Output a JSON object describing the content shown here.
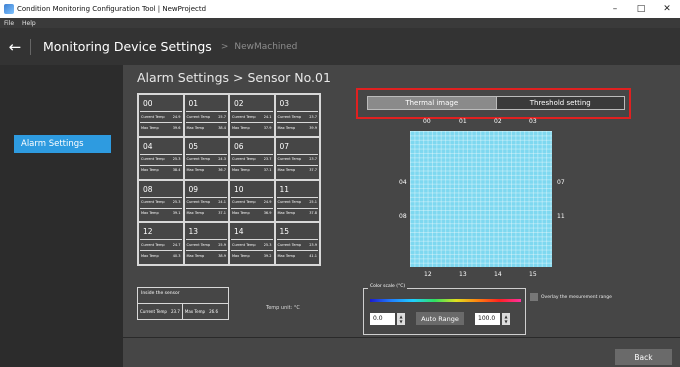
{
  "window": {
    "title": "Condition Monitoring Configuration Tool | NewProjectd",
    "controls": [
      "–",
      "□",
      "✕"
    ]
  },
  "menu": [
    "File",
    "Help"
  ],
  "header": {
    "back_icon": "arrow-left-icon",
    "title": "Monitoring Device Settings",
    "breadcrumb_sep": ">",
    "breadcrumb": "NewMachined"
  },
  "sidebar": {
    "items": [
      {
        "label": "Alarm Settings",
        "selected": true
      }
    ]
  },
  "page": {
    "title": "Alarm Settings > Sensor No.01"
  },
  "sensors": {
    "cells": [
      {
        "id": "00",
        "current_label": "Current Temp",
        "current": "24.9",
        "max_label": "Max Temp",
        "max": "39.6"
      },
      {
        "id": "01",
        "current_label": "Current Temp",
        "current": "25.7",
        "max_label": "Max Temp",
        "max": "38.4"
      },
      {
        "id": "02",
        "current_label": "Current Temp",
        "current": "24.1",
        "max_label": "Max Temp",
        "max": "37.9"
      },
      {
        "id": "03",
        "current_label": "Current Temp",
        "current": "23.7",
        "max_label": "Max Temp",
        "max": "39.9"
      },
      {
        "id": "04",
        "current_label": "Current Temp",
        "current": "25.3",
        "max_label": "Max Temp",
        "max": "38.4"
      },
      {
        "id": "05",
        "current_label": "Current Temp",
        "current": "24.3",
        "max_label": "Max Temp",
        "max": "36.7"
      },
      {
        "id": "06",
        "current_label": "Current Temp",
        "current": "23.7",
        "max_label": "Max Temp",
        "max": "37.1"
      },
      {
        "id": "07",
        "current_label": "Current Temp",
        "current": "23.7",
        "max_label": "Max Temp",
        "max": "37.7"
      },
      {
        "id": "08",
        "current_label": "Current Temp",
        "current": "25.3",
        "max_label": "Max Temp",
        "max": "39.1"
      },
      {
        "id": "09",
        "current_label": "Current Temp",
        "current": "24.1",
        "max_label": "Max Temp",
        "max": "37.1"
      },
      {
        "id": "10",
        "current_label": "Current Temp",
        "current": "24.9",
        "max_label": "Max Temp",
        "max": "36.9"
      },
      {
        "id": "11",
        "current_label": "Current Temp",
        "current": "25.1",
        "max_label": "Max Temp",
        "max": "37.8"
      },
      {
        "id": "12",
        "current_label": "Current Temp",
        "current": "24.7",
        "max_label": "Max Temp",
        "max": "40.3"
      },
      {
        "id": "13",
        "current_label": "Current Temp",
        "current": "25.9",
        "max_label": "Max Temp",
        "max": "38.9"
      },
      {
        "id": "14",
        "current_label": "Current Temp",
        "current": "25.3",
        "max_label": "Max Temp",
        "max": "39.2"
      },
      {
        "id": "15",
        "current_label": "Current Temp",
        "current": "23.9",
        "max_label": "Max Temp",
        "max": "41.1"
      }
    ],
    "inside": {
      "label": "Inside the sensor",
      "current_label": "Current Temp",
      "current": "23.7",
      "max_label": "Max Temp",
      "max": "26.6"
    },
    "unit": "Temp unit: °C"
  },
  "tabs": [
    {
      "label": "Thermal image",
      "active": true
    },
    {
      "label": "Threshold setting",
      "active": false
    }
  ],
  "thermal": {
    "col_labels": [
      "00",
      "01",
      "02",
      "03"
    ],
    "bottom_labels": [
      "12",
      "13",
      "14",
      "15"
    ],
    "left_labels": [
      "04",
      "08"
    ],
    "right_labels": [
      "07",
      "11"
    ],
    "color": "#7ed8f0"
  },
  "color_scale": {
    "legend": "Color scale (°C)",
    "min": "0.0",
    "auto_range": "Auto Range",
    "max": "100.0",
    "overlay_label": "Overlay the mesurement range",
    "overlay_checked": false
  },
  "footer": {
    "back": "Back"
  },
  "colors": {
    "accent": "#2e9be0",
    "highlight": "#e02020"
  }
}
